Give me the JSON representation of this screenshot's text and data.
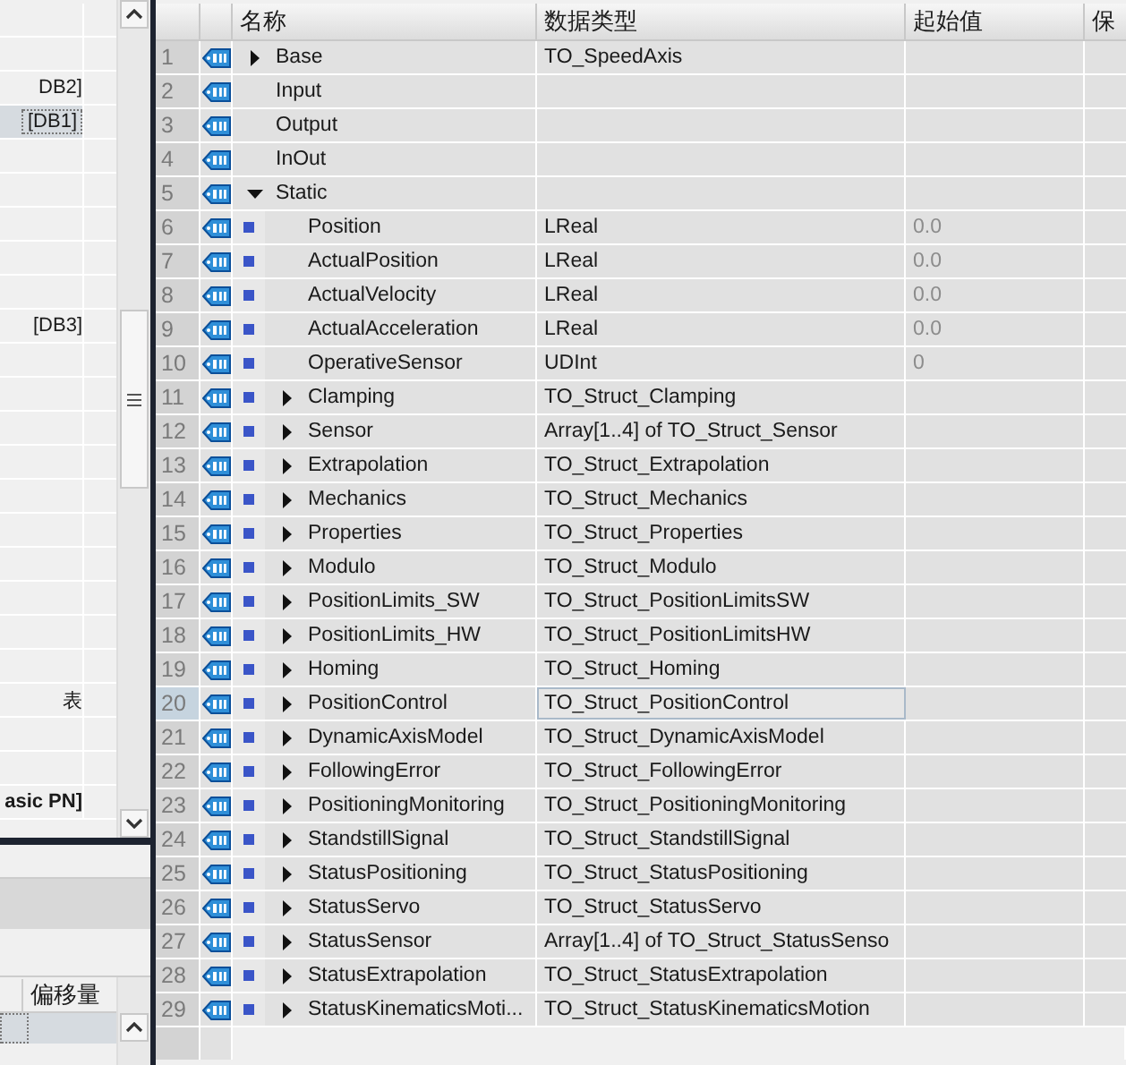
{
  "project_tree": {
    "rows": [
      {
        "selected": false
      },
      {
        "selected": false
      },
      {
        "text": "DB2]",
        "selected": false
      },
      {
        "text": "[DB1]",
        "selected": true
      },
      {
        "selected": false
      },
      {
        "selected": false
      },
      {
        "selected": false
      },
      {
        "selected": false
      },
      {
        "selected": false
      },
      {
        "text": "[DB3]",
        "selected": false
      },
      {
        "selected": false
      },
      {
        "selected": false
      },
      {
        "selected": false
      },
      {
        "selected": false
      },
      {
        "selected": false
      },
      {
        "selected": false
      },
      {
        "selected": false
      },
      {
        "selected": false
      },
      {
        "selected": false
      },
      {
        "selected": false
      },
      {
        "text": "表",
        "selected": false
      },
      {
        "selected": false
      },
      {
        "selected": false
      },
      {
        "text": "asic PN]",
        "bold": true,
        "selected": false
      }
    ]
  },
  "bottom_panel": {
    "columns": [
      "偏移量"
    ],
    "rows": [
      {
        "selected": true
      }
    ]
  },
  "table": {
    "columns": [
      "名称",
      "数据类型",
      "起始值",
      "保"
    ],
    "rows": [
      {
        "no": "1",
        "name": "Base",
        "type": "TO_SpeedAxis",
        "expanded": false,
        "selected": false
      },
      {
        "no": "2",
        "name": "Input",
        "selected": false
      },
      {
        "no": "3",
        "name": "Output",
        "selected": false
      },
      {
        "no": "4",
        "name": "InOut",
        "selected": false
      },
      {
        "no": "5",
        "name": "Static",
        "expanded": true,
        "selected": false,
        "children": [
          {
            "no": "6",
            "name": "Position",
            "type": "LReal",
            "start": "0.0",
            "selected": false
          },
          {
            "no": "7",
            "name": "ActualPosition",
            "type": "LReal",
            "start": "0.0",
            "selected": false
          },
          {
            "no": "8",
            "name": "ActualVelocity",
            "type": "LReal",
            "start": "0.0",
            "selected": false
          },
          {
            "no": "9",
            "name": "ActualAcceleration",
            "type": "LReal",
            "start": "0.0",
            "selected": false
          },
          {
            "no": "10",
            "name": "OperativeSensor",
            "type": "UDInt",
            "start": "0",
            "selected": false
          },
          {
            "no": "11",
            "name": "Clamping",
            "type": "TO_Struct_Clamping",
            "expanded": false,
            "selected": false
          },
          {
            "no": "12",
            "name": "Sensor",
            "type": "Array[1..4] of TO_Struct_Sensor",
            "expanded": false,
            "selected": false
          },
          {
            "no": "13",
            "name": "Extrapolation",
            "type": "TO_Struct_Extrapolation",
            "expanded": false,
            "selected": false
          },
          {
            "no": "14",
            "name": "Mechanics",
            "type": "TO_Struct_Mechanics",
            "expanded": false,
            "selected": false
          },
          {
            "no": "15",
            "name": "Properties",
            "type": "TO_Struct_Properties",
            "expanded": false,
            "selected": false
          },
          {
            "no": "16",
            "name": "Modulo",
            "type": "TO_Struct_Modulo",
            "expanded": false,
            "selected": false
          },
          {
            "no": "17",
            "name": "PositionLimits_SW",
            "type": "TO_Struct_PositionLimitsSW",
            "expanded": false,
            "selected": false
          },
          {
            "no": "18",
            "name": "PositionLimits_HW",
            "type": "TO_Struct_PositionLimitsHW",
            "expanded": false,
            "selected": false
          },
          {
            "no": "19",
            "name": "Homing",
            "type": "TO_Struct_Homing",
            "expanded": false,
            "selected": false
          },
          {
            "no": "20",
            "name": "PositionControl",
            "type": "TO_Struct_PositionControl",
            "expanded": false,
            "selected": true
          },
          {
            "no": "21",
            "name": "DynamicAxisModel",
            "type": "TO_Struct_DynamicAxisModel",
            "expanded": false,
            "selected": false
          },
          {
            "no": "22",
            "name": "FollowingError",
            "type": "TO_Struct_FollowingError",
            "expanded": false,
            "selected": false
          },
          {
            "no": "23",
            "name": "PositioningMonitoring",
            "type": "TO_Struct_PositioningMonitoring",
            "expanded": false,
            "selected": false
          },
          {
            "no": "24",
            "name": "StandstillSignal",
            "type": "TO_Struct_StandstillSignal",
            "expanded": false,
            "selected": false
          },
          {
            "no": "25",
            "name": "StatusPositioning",
            "type": "TO_Struct_StatusPositioning",
            "expanded": false,
            "selected": false
          },
          {
            "no": "26",
            "name": "StatusServo",
            "type": "TO_Struct_StatusServo",
            "expanded": false,
            "selected": false
          },
          {
            "no": "27",
            "name": "StatusSensor",
            "type": "Array[1..4] of TO_Struct_StatusSenso",
            "expanded": false,
            "selected": false
          },
          {
            "no": "28",
            "name": "StatusExtrapolation",
            "type": "TO_Struct_StatusExtrapolation",
            "expanded": false,
            "selected": false
          },
          {
            "no": "29",
            "name": "StatusKinematicsMoti...",
            "type": "TO_Struct_StatusKinematicsMotion",
            "expanded": false,
            "selected": false
          }
        ]
      }
    ]
  }
}
